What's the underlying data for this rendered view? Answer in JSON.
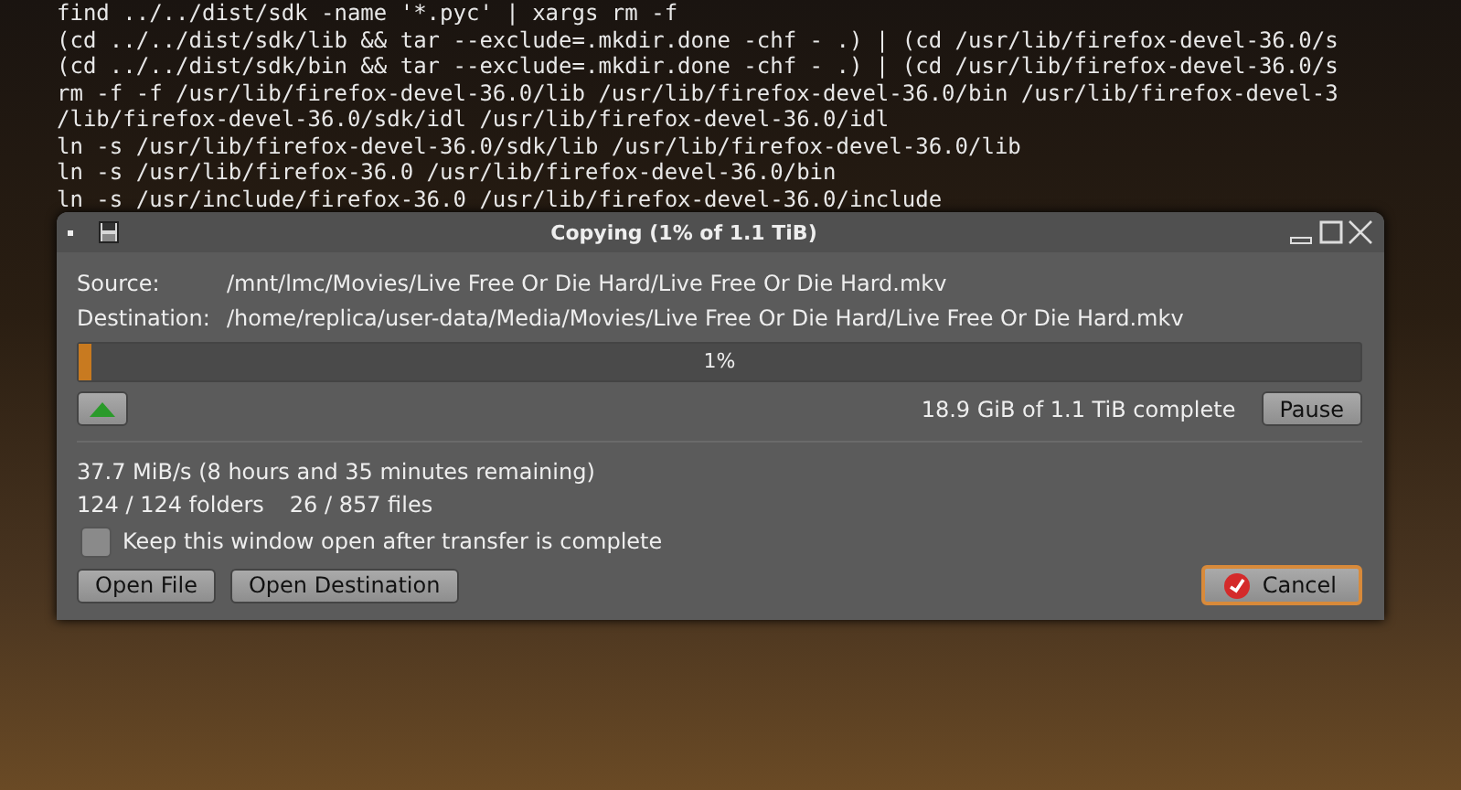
{
  "terminal": {
    "lines": [
      "find ../../dist/sdk -name '*.pyc' | xargs rm -f",
      "(cd ../../dist/sdk/lib && tar --exclude=.mkdir.done -chf - .) | (cd /usr/lib/firefox-devel-36.0/s",
      "(cd ../../dist/sdk/bin && tar --exclude=.mkdir.done -chf - .) | (cd /usr/lib/firefox-devel-36.0/s",
      "rm -f -f /usr/lib/firefox-devel-36.0/lib /usr/lib/firefox-devel-36.0/bin /usr/lib/firefox-devel-3",
      "/lib/firefox-devel-36.0/sdk/idl /usr/lib/firefox-devel-36.0/idl",
      "ln -s /usr/lib/firefox-devel-36.0/sdk/lib /usr/lib/firefox-devel-36.0/lib",
      "ln -s /usr/lib/firefox-36.0 /usr/lib/firefox-devel-36.0/bin",
      "ln -s /usr/include/firefox-36.0 /usr/lib/firefox-devel-36.0/include"
    ]
  },
  "window": {
    "title": "Copying (1% of 1.1 TiB)"
  },
  "fields": [
    {
      "label": "Source:",
      "value": "/mnt/lmc/Movies/Live Free Or Die Hard/Live Free Or Die Hard.mkv"
    },
    {
      "label": "Destination:",
      "value": "/home/replica/user-data/Media/Movies/Live Free Or Die Hard/Live Free Or Die Hard.mkv"
    }
  ],
  "progress": {
    "level": 0.01,
    "label": "1%"
  },
  "summary": "18.9 GiB of 1.1 TiB complete",
  "pause_button": "Pause",
  "speed": "37.7 MiB/s (8 hours and 35 minutes remaining)",
  "counts": [
    "124 / 124 folders",
    "26 / 857 files"
  ],
  "keep_open": {
    "label": "Keep this window open after transfer is complete",
    "checked": false
  },
  "buttons": [
    "Open File",
    "Open Destination"
  ],
  "cancel_button": "Cancel"
}
